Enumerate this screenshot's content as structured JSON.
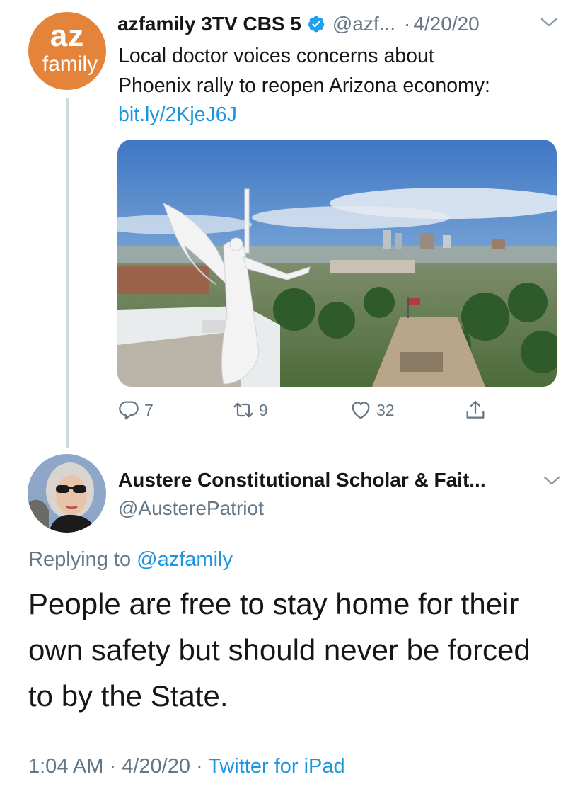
{
  "parent_tweet": {
    "avatar_text_top": "az",
    "avatar_text_bottom": "family",
    "display_name": "azfamily 3TV CBS 5",
    "handle": "@azf...",
    "separator": "·",
    "date": "4/20/20",
    "text_lines": [
      "Local doctor voices concerns about",
      "Phoenix rally to reopen Arizona economy:"
    ],
    "link": "bit.ly/2KjeJ6J",
    "actions": {
      "replies": "7",
      "retweets": "9",
      "likes": "32"
    }
  },
  "reply_tweet": {
    "display_name": "Austere Constitutional Scholar & Fait...",
    "handle": "@AusterePatriot",
    "replying_prefix": "Replying to",
    "replying_to": "@azfamily",
    "text_lines": [
      "People are free to stay home for their",
      "own safety but should never be forced",
      "to by the State."
    ],
    "time": "1:04 AM",
    "separator": "·",
    "date": "4/20/20",
    "source_separator": "·",
    "source": "Twitter for iPad"
  },
  "colors": {
    "link_blue": "#1b95e0",
    "secondary_gray": "#657786",
    "avatar_orange": "#e4843a",
    "thread_line": "#cfd9de"
  },
  "icons": [
    "verified-badge-icon",
    "chevron-down-icon",
    "reply-icon",
    "retweet-icon",
    "like-icon",
    "share-icon"
  ]
}
